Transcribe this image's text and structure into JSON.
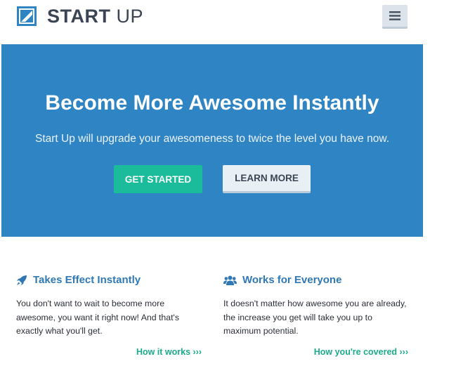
{
  "header": {
    "brand_bold": "START",
    "brand_light": "UP",
    "menu_icon": "hamburger-menu-icon"
  },
  "hero": {
    "title": "Become More Awesome Instantly",
    "subtitle": "Start Up will upgrade your awesomeness to twice the level you have now.",
    "primary_button": "GET STARTED",
    "secondary_button": "LEARN MORE"
  },
  "features": [
    {
      "icon": "rocket-icon",
      "title": "Takes Effect Instantly",
      "body": "You don't want to wait to become more awesome, you want it right now! And that's exactly what you'll get.",
      "link": "How it works ›››"
    },
    {
      "icon": "users-icon",
      "title": "Works for Everyone",
      "body": "It doesn't matter how awesome you are already, the increase you get will take you up to maximum potential.",
      "link": "How you're covered ›››"
    }
  ],
  "colors": {
    "hero_bg": "#2f84c3",
    "accent_green": "#1bbc9b",
    "heading_blue": "#2f78b5",
    "brand_text": "#3a4452"
  }
}
